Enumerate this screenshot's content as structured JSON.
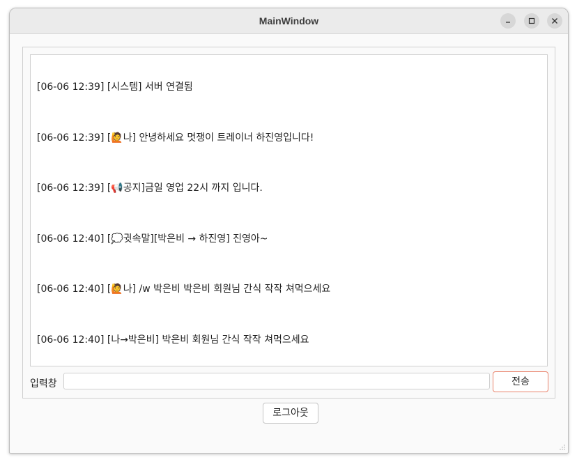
{
  "window": {
    "title": "MainWindow"
  },
  "chat": {
    "messages": [
      "[06-06 12:39] [시스템] 서버 연결됨",
      "[06-06 12:39] [🙋나] 안녕하세요 멋쟁이 트레이너 하진영입니다!",
      "[06-06 12:39] [📢공지]금일 영업 22시 까지 입니다.",
      "[06-06 12:40] [💭귓속말][박은비 → 하진영] 진영아~",
      "[06-06 12:40] [🙋나] /w 박은비 박은비 회원님 간식 작작 쳐먹으세요",
      "[06-06 12:40] [나→박은비] 박은비 회원님 간식 작작 쳐먹으세요"
    ]
  },
  "input": {
    "label": "입력창",
    "value": ""
  },
  "buttons": {
    "send_label": "전송",
    "logout_label": "로그아웃"
  },
  "colors": {
    "send_border": "#e9826a",
    "titlebar": "#ebebeb"
  }
}
